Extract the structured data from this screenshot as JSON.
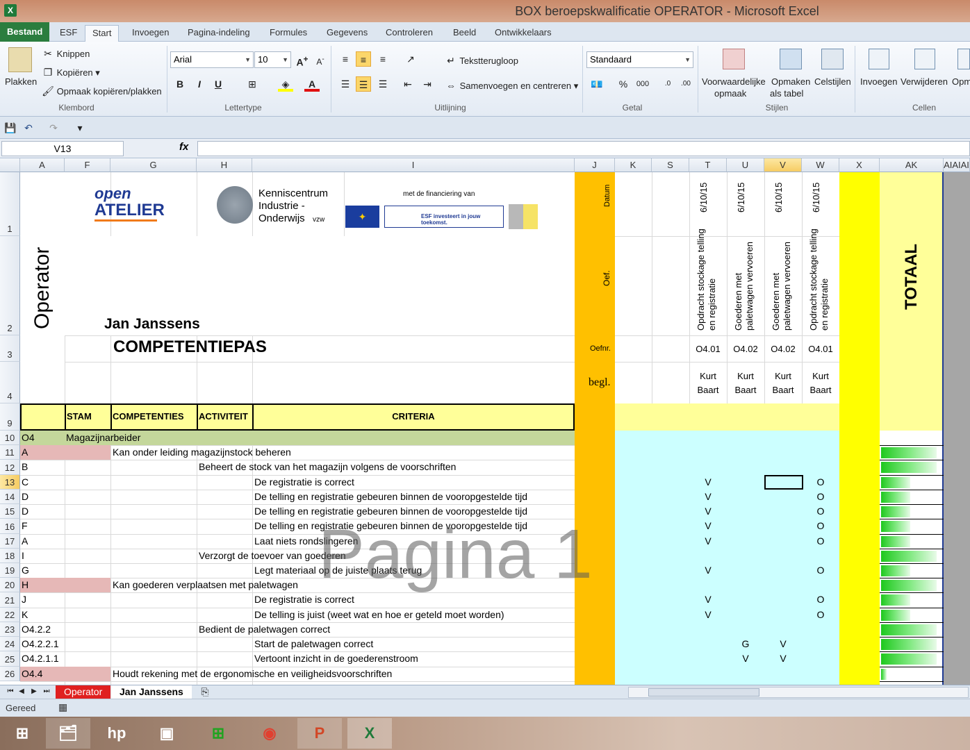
{
  "window": {
    "title": "BOX beroepskwalificatie OPERATOR  -  Microsoft Excel",
    "app_icon": "excel-icon"
  },
  "ribbon_tabs": [
    "Bestand",
    "ESF",
    "Start",
    "Invoegen",
    "Pagina-indeling",
    "Formules",
    "Gegevens",
    "Controleren",
    "Beeld",
    "Ontwikkelaars"
  ],
  "ribbon": {
    "clipboard": {
      "paste": "Plakken",
      "cut": "Knippen",
      "copy": "Kopiëren",
      "format_painter": "Opmaak kopiëren/plakken",
      "group": "Klembord"
    },
    "font": {
      "name": "Arial",
      "size": "10",
      "bold": "B",
      "italic": "I",
      "underline": "U",
      "group": "Lettertype"
    },
    "alignment": {
      "wrap": "Tekstterugloop",
      "merge": "Samenvoegen en centreren",
      "group": "Uitlijning"
    },
    "number": {
      "format": "Standaard",
      "percent": "%",
      "thousands": "000",
      "group": "Getal"
    },
    "styles": {
      "conditional": "Voorwaardelijke",
      "conditional2": "opmaak",
      "table": "Opmaken",
      "table2": "als tabel",
      "cell_styles": "Celstijlen",
      "group": "Stijlen"
    },
    "cells": {
      "insert": "Invoegen",
      "delete": "Verwijderen",
      "format": "Opm",
      "group": "Cellen"
    }
  },
  "formula_bar": {
    "name_box": "V13",
    "fx": "fx",
    "value": ""
  },
  "columns": [
    "A",
    "F",
    "G",
    "H",
    "I",
    "J",
    "K",
    "S",
    "T",
    "U",
    "V",
    "W",
    "X",
    "AK",
    "AIAIAI"
  ],
  "rows": [
    "1",
    "2",
    "3",
    "4",
    "9",
    "10",
    "11",
    "12",
    "13",
    "14",
    "15",
    "16",
    "17",
    "18",
    "19",
    "20",
    "21",
    "22",
    "23",
    "24",
    "25",
    "26"
  ],
  "sheet": {
    "operator": "Operator",
    "name": "Jan Janssens",
    "title": "COMPETENTIEPAS",
    "logo_open": "open",
    "logo_atelier": "ATELIER",
    "kio_1": "Kenniscentrum",
    "kio_2": "Industrie -",
    "kio_3": "Onderwijs",
    "kio_vzw": "vzw",
    "financing": "met de financiering van",
    "esf_text": "ESF investeert in jouw toekomst.",
    "label_datum": "Datum",
    "label_oef": "Oef.",
    "label_oefnr": "Oefnr.",
    "label_begl": "begl.",
    "totaal": "TOTAAL",
    "headers": {
      "stam": "STAM",
      "competenties": "COMPETENTIES",
      "activiteit": "ACTIVITEIT",
      "criteria": "CRITERIA"
    },
    "exercises": [
      {
        "date": "6/10/15",
        "line1": "Opdracht stockage telling",
        "line2": "en registratie",
        "nr": "O4.01",
        "b1": "Kurt",
        "b2": "Baart"
      },
      {
        "date": "6/10/15",
        "line1": "Goederen met",
        "line2": "paletwagen vervoeren",
        "nr": "O4.02",
        "b1": "Kurt",
        "b2": "Baart"
      },
      {
        "date": "6/10/15",
        "line1": "Goederen met",
        "line2": "paletwagen vervoeren",
        "nr": "O4.02",
        "b1": "Kurt",
        "b2": "Baart"
      },
      {
        "date": "6/10/15",
        "line1": "Opdracht stockage telling",
        "line2": "en registratie",
        "nr": "O4.01",
        "b1": "Kurt",
        "b2": "Baart"
      }
    ],
    "data_rows": [
      {
        "row": "10",
        "a": "O4",
        "text": "Magazijnarbeider",
        "level": "F",
        "t": "",
        "u": "",
        "v": "",
        "w": "",
        "bar": 0
      },
      {
        "row": "11",
        "a": "A",
        "text": "Kan onder leiding magazijnstock beheren",
        "level": "G",
        "t": "",
        "u": "",
        "v": "",
        "w": "",
        "bar": 0.95
      },
      {
        "row": "12",
        "a": "B",
        "text": "Beheert de stock van het magazijn volgens de voorschriften",
        "level": "H",
        "t": "",
        "u": "",
        "v": "",
        "w": "",
        "bar": 0.95
      },
      {
        "row": "13",
        "a": "C",
        "text": "De registratie is correct",
        "level": "I",
        "t": "V",
        "u": "",
        "v": "",
        "w": "O",
        "bar": 0.5
      },
      {
        "row": "14",
        "a": "D",
        "text": "De telling en registratie gebeuren binnen de vooropgestelde tijd",
        "level": "I",
        "t": "V",
        "u": "",
        "v": "",
        "w": "O",
        "bar": 0.5
      },
      {
        "row": "15",
        "a": "D",
        "text": "De telling en registratie gebeuren binnen de vooropgestelde tijd",
        "level": "I",
        "t": "V",
        "u": "",
        "v": "",
        "w": "O",
        "bar": 0.5
      },
      {
        "row": "16",
        "a": "F",
        "text": "De telling en registratie gebeuren binnen de vooropgestelde tijd",
        "level": "I",
        "t": "V",
        "u": "",
        "v": "",
        "w": "O",
        "bar": 0.5
      },
      {
        "row": "17",
        "a": "A",
        "text": "Laat niets rondslingeren",
        "level": "I",
        "t": "V",
        "u": "",
        "v": "",
        "w": "O",
        "bar": 0.5
      },
      {
        "row": "18",
        "a": "I",
        "text": "Verzorgt de toevoer van goederen",
        "level": "H",
        "t": "",
        "u": "",
        "v": "",
        "w": "",
        "bar": 0.95
      },
      {
        "row": "19",
        "a": "G",
        "text": "Legt materiaal op de juiste plaats terug",
        "level": "I",
        "t": "V",
        "u": "",
        "v": "",
        "w": "O",
        "bar": 0.5
      },
      {
        "row": "20",
        "a": "H",
        "text": "Kan goederen verplaatsen met paletwagen",
        "level": "G",
        "t": "",
        "u": "",
        "v": "",
        "w": "",
        "bar": 0.95
      },
      {
        "row": "21",
        "a": "J",
        "text": "De registratie is correct",
        "level": "I",
        "t": "V",
        "u": "",
        "v": "",
        "w": "O",
        "bar": 0.5
      },
      {
        "row": "22",
        "a": "K",
        "text": "De telling is juist (weet wat en hoe er geteld moet worden)",
        "level": "I",
        "t": "V",
        "u": "",
        "v": "",
        "w": "O",
        "bar": 0.5
      },
      {
        "row": "23",
        "a": "O4.2.2",
        "text": "Bedient de paletwagen correct",
        "level": "H",
        "t": "",
        "u": "",
        "v": "",
        "w": "",
        "bar": 0.95
      },
      {
        "row": "24",
        "a": "O4.2.2.1",
        "text": "Start de paletwagen correct",
        "level": "I",
        "t": "",
        "u": "G",
        "v": "V",
        "w": "",
        "bar": 0.95
      },
      {
        "row": "25",
        "a": "O4.2.1.1",
        "text": "Vertoont inzicht in de goederenstroom",
        "level": "I",
        "t": "",
        "u": "V",
        "v": "V",
        "w": "",
        "bar": 0.95
      },
      {
        "row": "26",
        "a": "O4.4",
        "text": "Houdt rekening met de ergonomische en veiligheidsvoorschriften",
        "level": "G",
        "t": "",
        "u": "",
        "v": "",
        "w": "",
        "bar": 0.1
      }
    ],
    "watermark": "Pagina 1"
  },
  "sheet_tabs": [
    "Operator",
    "Jan Janssens"
  ],
  "status": {
    "ready": "Gereed"
  },
  "colors": {
    "accent_orange": "#FFC000",
    "yellow": "#FFFF00",
    "light_yellow": "#FFFF99",
    "light_cyan": "#CCFFFF",
    "pink": "#E6B8B7",
    "green_row": "#C4D79B",
    "excel_green": "#2A7D3E"
  },
  "taskbar_icons": [
    "windows-start-icon",
    "file-explorer-icon",
    "hp-icon",
    "video-icon",
    "store-icon",
    "chrome-icon",
    "powerpoint-icon",
    "excel-icon"
  ]
}
